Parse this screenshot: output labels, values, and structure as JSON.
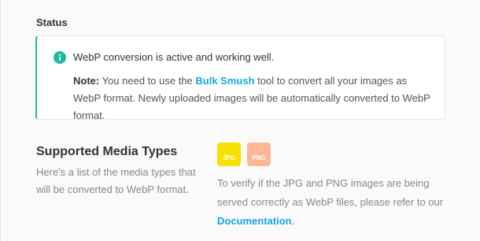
{
  "status": {
    "heading": "Status",
    "message": "WebP conversion is active and working well.",
    "note_label": "Note:",
    "note_before": " You need to use the ",
    "note_link": "Bulk Smush",
    "note_after": " tool to convert all your images as WebP format. Newly uploaded images will be automatically converted to WebP format.",
    "accent_color": "#1abc9c",
    "icon": "info-icon"
  },
  "media_types": {
    "heading": "Supported Media Types",
    "description": "Here's a list of the media types that will be converted to WebP format.",
    "badges": [
      {
        "label": "JPG",
        "color": "#f7e100"
      },
      {
        "label": "PNG",
        "color": "#ffb694"
      }
    ],
    "verify_before": "To verify if the JPG and PNG images are being served correctly as WebP files, please refer to our ",
    "verify_link": "Documentation",
    "verify_after": "."
  },
  "link_color": "#17a8e3"
}
